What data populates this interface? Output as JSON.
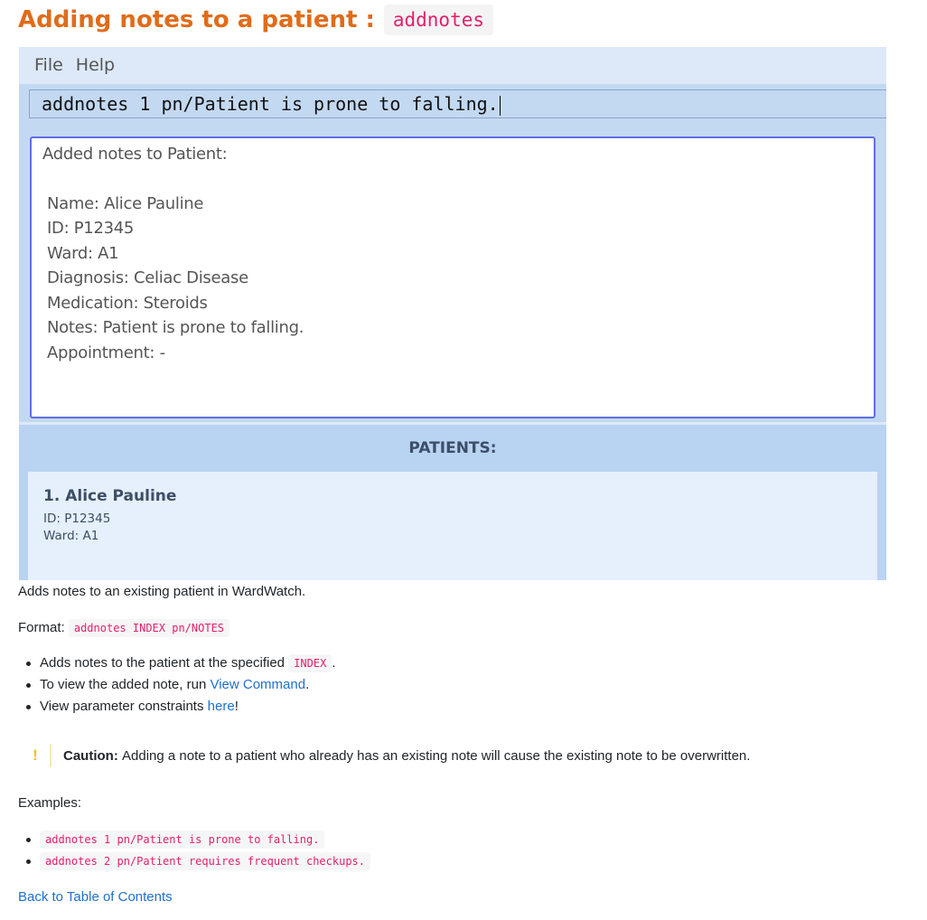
{
  "heading": {
    "text": "Adding notes to a patient :",
    "command": "addnotes"
  },
  "app": {
    "menu": [
      "File",
      "Help"
    ],
    "command_input": "addnotes 1 pn/Patient is prone to falling.",
    "result": {
      "title": "Added notes to Patient:",
      "lines": [
        "Name: Alice Pauline",
        "ID: P12345",
        "Ward: A1",
        "Diagnosis: Celiac Disease",
        "Medication: Steroids",
        "Notes: Patient is prone to falling.",
        "Appointment: -"
      ]
    },
    "patients_header": "PATIENTS:",
    "patient_card": {
      "name": "1.  Alice Pauline",
      "id": "ID: P12345",
      "ward": "Ward: A1"
    }
  },
  "doc": {
    "description": "Adds notes to an existing patient in WardWatch.",
    "format_label": "Format:",
    "format_code": "addnotes INDEX pn/NOTES",
    "bullets": {
      "b1_text": "Adds notes to the patient at the specified",
      "b1_code": "INDEX",
      "b1_end": ".",
      "b2_text": "To view the added note, run",
      "b2_link": "View Command",
      "b2_end": ".",
      "b3_text": "View parameter constraints",
      "b3_link": "here",
      "b3_end": "!"
    },
    "caution": {
      "icon": "!",
      "label": "Caution:",
      "text": "Adding a note to a patient who already has an existing note will cause the existing note to be overwritten."
    },
    "examples_label": "Examples:",
    "examples": [
      "addnotes 1 pn/Patient is prone to falling.",
      "addnotes 2 pn/Patient requires frequent checkups."
    ],
    "back_link": "Back to Table of Contents"
  }
}
